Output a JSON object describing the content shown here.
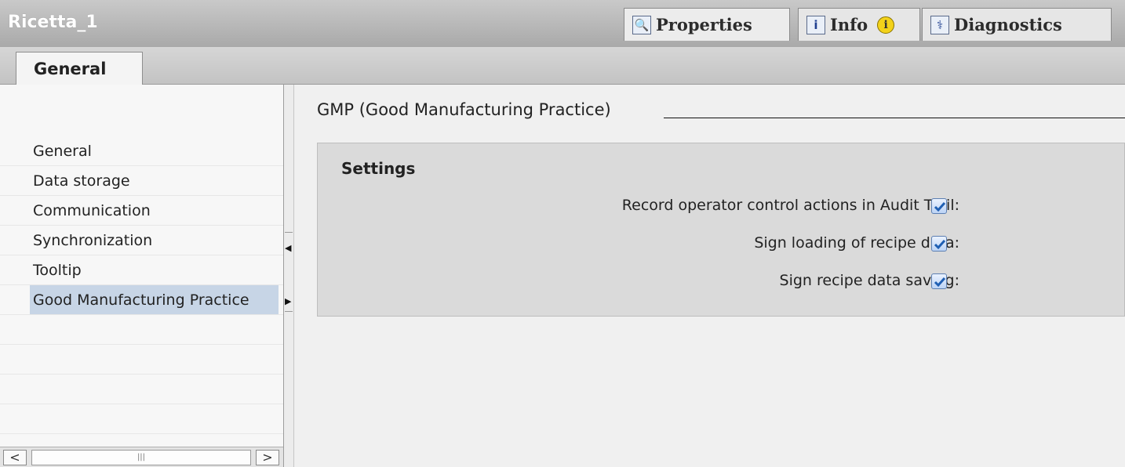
{
  "window": {
    "title": "Ricetta_1",
    "tabs": [
      {
        "label": "Properties",
        "icon": "properties-icon",
        "active": true
      },
      {
        "label": "Info",
        "icon": "info-icon",
        "badge": "i"
      },
      {
        "label": "Diagnostics",
        "icon": "diagnostics-icon"
      }
    ]
  },
  "subtabs": [
    {
      "label": "General",
      "active": true
    }
  ],
  "sidebar": {
    "items": [
      {
        "label": "General"
      },
      {
        "label": "Data storage"
      },
      {
        "label": "Communication"
      },
      {
        "label": "Synchronization"
      },
      {
        "label": "Tooltip"
      },
      {
        "label": "Good Manufacturing Practice",
        "selected": true
      }
    ],
    "scrollbar": {
      "left": "<",
      "right": ">",
      "thumb": "|||"
    }
  },
  "main": {
    "section_title": "GMP (Good Manufacturing Practice)",
    "group_title": "Settings",
    "options": [
      {
        "label": "Record operator control actions in Audit Trail:",
        "checked": true
      },
      {
        "label": "Sign loading of recipe data:",
        "checked": true
      },
      {
        "label": "Sign recipe data saving:",
        "checked": true
      }
    ]
  },
  "colors": {
    "selection": "#c7d5e6",
    "checkbox_accent": "#1f5fb3"
  }
}
